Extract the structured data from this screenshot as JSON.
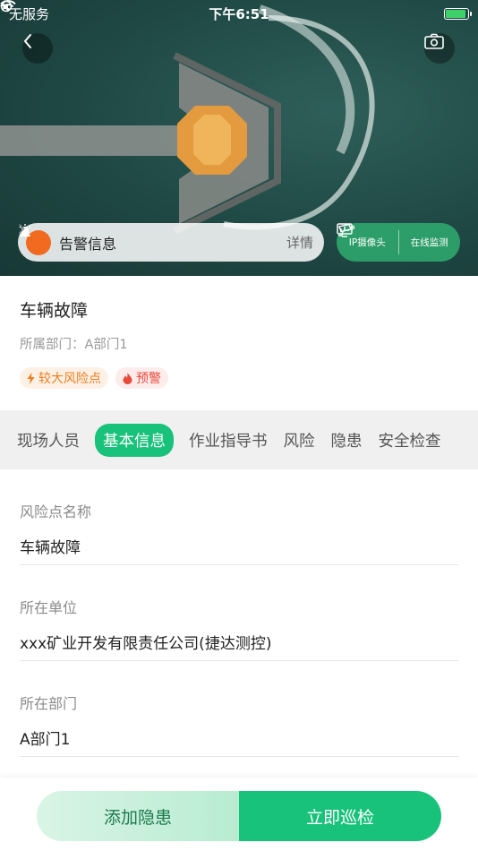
{
  "status_bar": {
    "carrier": "无服务",
    "time": "下午6:51"
  },
  "hero": {
    "alarm": {
      "label": "告警信息",
      "detail_label": "详情"
    },
    "monitor": {
      "ip_camera": "IP摄像头",
      "online_monitor": "在线监测"
    }
  },
  "info": {
    "title": "车辆故障",
    "dept_label": "所属部门：",
    "dept_value": "A部门1",
    "tags": {
      "risk": "较大风险点",
      "warning": "预警"
    }
  },
  "tabs": [
    "现场人员",
    "基本信息",
    "作业指导书",
    "风险",
    "隐患",
    "安全检查"
  ],
  "details": [
    {
      "label": "风险点名称",
      "value": "车辆故障"
    },
    {
      "label": "所在单位",
      "value": "xxx矿业开发有限责任公司(捷达测控)"
    },
    {
      "label": "所在部门",
      "value": "A部门1"
    }
  ],
  "actions": {
    "add_hazard": "添加隐患",
    "patrol_now": "立即巡检"
  },
  "colors": {
    "accent": "#19c27a",
    "alarm": "#f26a1f",
    "tag_orange": "#f07d1c",
    "tag_red": "#e84a3c"
  }
}
